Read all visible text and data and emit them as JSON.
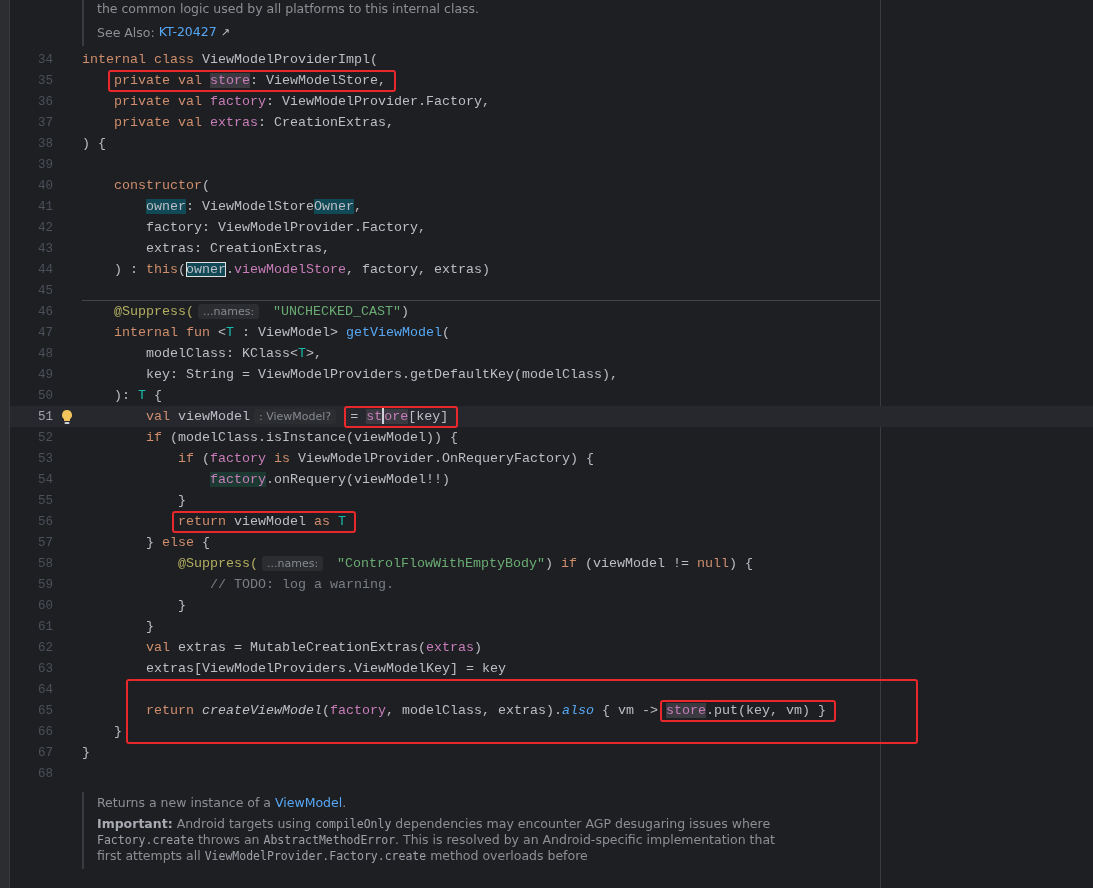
{
  "top_doc": {
    "text": "the common logic used by all platforms to this internal class.",
    "see_also_label": "See Also:",
    "see_also_link": "KT-20427",
    "link_icon": "↗"
  },
  "lines": [
    {
      "number": "34",
      "tokens": [
        {
          "t": "internal class ",
          "kind": "kw"
        },
        {
          "t": "ViewModelProviderImpl(",
          "kind": "plain"
        }
      ]
    },
    {
      "number": "35",
      "tokens": [
        {
          "t": "    private val ",
          "kind": "kw",
          "box": true
        },
        {
          "t": "store",
          "kind": "prop",
          "occurrence": true,
          "box": true
        },
        {
          "t": ": ViewModelStore,",
          "kind": "plain",
          "box": true
        }
      ]
    },
    {
      "number": "36",
      "tokens": [
        {
          "t": "    private val ",
          "kind": "kw"
        },
        {
          "t": "factory",
          "kind": "prop"
        },
        {
          "t": ": ViewModelProvider.Factory,",
          "kind": "plain"
        }
      ]
    },
    {
      "number": "37",
      "tokens": [
        {
          "t": "    private val ",
          "kind": "kw"
        },
        {
          "t": "extras",
          "kind": "prop"
        },
        {
          "t": ": CreationExtras,",
          "kind": "plain"
        }
      ]
    },
    {
      "number": "38",
      "tokens": [
        {
          "t": ") {",
          "kind": "plain"
        }
      ]
    },
    {
      "number": "39"
    },
    {
      "number": "40",
      "tokens": [
        {
          "t": "    constructor",
          "kind": "kw"
        },
        {
          "t": "(",
          "kind": "plain"
        }
      ]
    },
    {
      "number": "41",
      "tokens": [
        {
          "t": "        owner",
          "kind": "plain",
          "search_match": true
        },
        {
          "t": ": ViewModelStore",
          "kind": "plain"
        },
        {
          "t": "Owner",
          "kind": "plain",
          "search_match": true
        },
        {
          "t": ",",
          "kind": "plain"
        }
      ]
    },
    {
      "number": "42",
      "tokens": [
        {
          "t": "        factory: ViewModelProvider.Factory,",
          "kind": "plain"
        }
      ]
    },
    {
      "number": "43",
      "tokens": [
        {
          "t": "        extras: CreationExtras,",
          "kind": "plain"
        }
      ]
    },
    {
      "number": "44",
      "tokens": [
        {
          "t": "    ) : ",
          "kind": "plain"
        },
        {
          "t": "this",
          "kind": "kw"
        },
        {
          "t": "(",
          "kind": "plain"
        },
        {
          "t": "owner",
          "kind": "plain",
          "search_match": true,
          "current_match": true
        },
        {
          "t": ".",
          "kind": "plain"
        },
        {
          "t": "viewModelStore",
          "kind": "prop"
        },
        {
          "t": ", factory, extras)",
          "kind": "plain"
        }
      ]
    },
    {
      "number": "45"
    },
    {
      "number": "46",
      "separator_above": true,
      "tokens": [
        {
          "t": "    @Suppress(",
          "kind": "annotation"
        },
        {
          "t": "...names:",
          "kind": "hint"
        },
        {
          "t": "\"UNCHECKED_CAST\"",
          "kind": "str"
        },
        {
          "t": ")",
          "kind": "plain"
        }
      ]
    },
    {
      "number": "47",
      "tokens": [
        {
          "t": "    internal fun ",
          "kind": "kw"
        },
        {
          "t": "<",
          "kind": "plain"
        },
        {
          "t": "T",
          "kind": "tp"
        },
        {
          "t": " : ViewModel> ",
          "kind": "plain"
        },
        {
          "t": "getViewModel",
          "kind": "fn"
        },
        {
          "t": "(",
          "kind": "plain"
        }
      ]
    },
    {
      "number": "48",
      "tokens": [
        {
          "t": "        modelClass: KClass<",
          "kind": "plain"
        },
        {
          "t": "T",
          "kind": "tp"
        },
        {
          "t": ">,",
          "kind": "plain"
        }
      ]
    },
    {
      "number": "49",
      "tokens": [
        {
          "t": "        key: String = ViewModelProviders.getDefaultKey(modelClass),",
          "kind": "plain"
        }
      ]
    },
    {
      "number": "50",
      "tokens": [
        {
          "t": "    ): ",
          "kind": "plain"
        },
        {
          "t": "T",
          "kind": "tp"
        },
        {
          "t": " {",
          "kind": "plain"
        }
      ]
    },
    {
      "number": "51",
      "current": true,
      "bulb": true,
      "tokens": [
        {
          "t": "        val ",
          "kind": "kw"
        },
        {
          "t": "viewModel",
          "kind": "plain"
        },
        {
          "t": ": ViewModel?",
          "kind": "hint"
        },
        {
          "t": "= ",
          "kind": "plain",
          "box": true
        },
        {
          "t": "st",
          "kind": "prop",
          "occurrence": true,
          "box": true,
          "caret": true
        },
        {
          "t": "ore",
          "kind": "prop",
          "occurrence": true,
          "box": true
        },
        {
          "t": "[key]",
          "kind": "plain",
          "box": true
        }
      ]
    },
    {
      "number": "52",
      "tokens": [
        {
          "t": "        if ",
          "kind": "kw"
        },
        {
          "t": "(modelClass.isInstance(viewModel)) {",
          "kind": "plain"
        }
      ]
    },
    {
      "number": "53",
      "tokens": [
        {
          "t": "            if ",
          "kind": "kw"
        },
        {
          "t": "(",
          "kind": "plain"
        },
        {
          "t": "factory",
          "kind": "prop"
        },
        {
          "t": " is",
          "kind": "kw"
        },
        {
          "t": " ViewModelProvider.OnRequeryFactory) {",
          "kind": "plain"
        }
      ]
    },
    {
      "number": "54",
      "tokens": [
        {
          "t": "                factory",
          "kind": "prop",
          "write_access": true
        },
        {
          "t": ".onRequery(viewModel!!)",
          "kind": "plain"
        }
      ]
    },
    {
      "number": "55",
      "tokens": [
        {
          "t": "            }",
          "kind": "plain"
        }
      ]
    },
    {
      "number": "56",
      "tokens": [
        {
          "t": "            return ",
          "kind": "kw",
          "box": true
        },
        {
          "t": "viewModel ",
          "kind": "plain",
          "box": true
        },
        {
          "t": "as ",
          "kind": "kw",
          "box": true
        },
        {
          "t": "T",
          "kind": "tp",
          "box": true
        }
      ]
    },
    {
      "number": "57",
      "tokens": [
        {
          "t": "        } ",
          "kind": "plain"
        },
        {
          "t": "else",
          "kind": "kw"
        },
        {
          "t": " {",
          "kind": "plain"
        }
      ]
    },
    {
      "number": "58",
      "tokens": [
        {
          "t": "            @Suppress(",
          "kind": "annotation"
        },
        {
          "t": "...names:",
          "kind": "hint"
        },
        {
          "t": "\"ControlFlowWithEmptyBody\"",
          "kind": "str"
        },
        {
          "t": ") ",
          "kind": "plain"
        },
        {
          "t": "if",
          "kind": "kw"
        },
        {
          "t": " (viewModel != ",
          "kind": "plain"
        },
        {
          "t": "null",
          "kind": "kw"
        },
        {
          "t": ") {",
          "kind": "plain"
        }
      ]
    },
    {
      "number": "59",
      "tokens": [
        {
          "t": "                // TODO: log a warning.",
          "kind": "comment"
        }
      ]
    },
    {
      "number": "60",
      "tokens": [
        {
          "t": "            }",
          "kind": "plain"
        }
      ]
    },
    {
      "number": "61",
      "tokens": [
        {
          "t": "        }",
          "kind": "plain"
        }
      ]
    },
    {
      "number": "62",
      "tokens": [
        {
          "t": "        val ",
          "kind": "kw"
        },
        {
          "t": "extras = MutableCreationExtras(",
          "kind": "plain"
        },
        {
          "t": "extras",
          "kind": "prop"
        },
        {
          "t": ")",
          "kind": "plain"
        }
      ]
    },
    {
      "number": "63",
      "tokens": [
        {
          "t": "        extras[ViewModelProviders.ViewModelKey] = key",
          "kind": "plain"
        }
      ]
    },
    {
      "number": "64",
      "block_box": true
    },
    {
      "number": "65",
      "block_box": true,
      "tokens": [
        {
          "t": "        return ",
          "kind": "kw"
        },
        {
          "t": "createViewModel",
          "kind": "italic"
        },
        {
          "t": "(",
          "kind": "plain"
        },
        {
          "t": "factory",
          "kind": "prop"
        },
        {
          "t": ", modelClass, extras).",
          "kind": "plain"
        },
        {
          "t": "also",
          "kind": "ext"
        },
        {
          "t": " { vm -> ",
          "kind": "plain"
        },
        {
          "t": "store",
          "kind": "prop",
          "occurrence": true,
          "box": true
        },
        {
          "t": ".put(key, vm) }",
          "kind": "plain",
          "box": true
        }
      ]
    },
    {
      "number": "66",
      "block_box": true,
      "tokens": [
        {
          "t": "    }",
          "kind": "plain"
        }
      ]
    },
    {
      "number": "67",
      "tokens": [
        {
          "t": "}",
          "kind": "plain"
        }
      ]
    },
    {
      "number": "68"
    }
  ],
  "bottom_doc": {
    "summary": [
      {
        "t": "Returns a new instance of a ",
        "kind": "text"
      },
      {
        "t": "ViewModel",
        "kind": "link"
      },
      {
        "t": ".",
        "kind": "text"
      }
    ],
    "important": [
      {
        "t": "Important:",
        "kind": "strong"
      },
      {
        "t": " Android targets using ",
        "kind": "text"
      },
      {
        "t": "compileOnly",
        "kind": "code"
      },
      {
        "t": " dependencies may encounter AGP desugaring issues where ",
        "kind": "text"
      },
      {
        "t": "Factory.create",
        "kind": "code"
      },
      {
        "t": " throws an ",
        "kind": "text"
      },
      {
        "t": "AbstractMethodError",
        "kind": "code"
      },
      {
        "t": ". This is resolved by an Android-specific implementation that first attempts all ",
        "kind": "text"
      },
      {
        "t": "ViewModelProvider.Factory.create",
        "kind": "code"
      },
      {
        "t": " method overloads before",
        "kind": "text"
      }
    ]
  }
}
